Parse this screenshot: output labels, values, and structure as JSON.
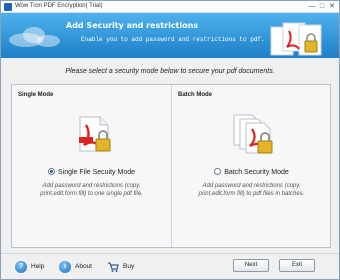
{
  "window": {
    "title": "Wow Tron PDF Encryption( Trial)",
    "controls": {
      "minimize": "—",
      "maximize": "□",
      "close": "✕"
    }
  },
  "banner": {
    "heading": "Add Security and restrictions",
    "subtitle": "Enable you to add password and restrictions to pdf.",
    "colors": {
      "top": "#4fb2ec",
      "bottom": "#1c7fc8"
    }
  },
  "prompt": "Please select a security mode below to secure your pdf documents.",
  "modes": {
    "single": {
      "group_label": "Single Mode",
      "option_label": "Single File Secuity Mode",
      "selected": true,
      "description": "Add password and restrictions (copy, print,edit,form fill) to one single pdf file."
    },
    "batch": {
      "group_label": "Batch Mode",
      "option_label": "Batch Security Mode",
      "selected": false,
      "description": "Add password and restrictions (copy, print,edit,form fill) to pdf files in batches."
    }
  },
  "footer": {
    "help_label": "Help",
    "about_label": "About",
    "buy_label": "Buy",
    "next_label": "Next",
    "exit_label": "Exit"
  },
  "icons": [
    "app-icon",
    "pdf-lock-icon",
    "pdf-stack-lock-icon",
    "help-icon",
    "info-icon",
    "cart-icon"
  ]
}
